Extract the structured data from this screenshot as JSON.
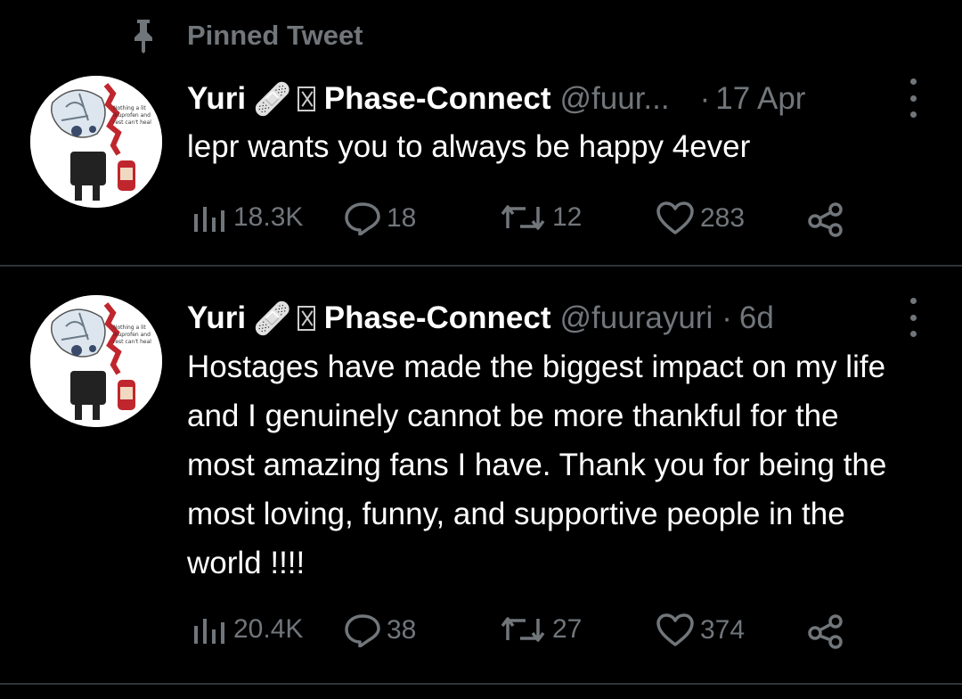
{
  "pinned": {
    "label": "Pinned Tweet",
    "icon": "pin-icon"
  },
  "tweets": [
    {
      "author_name": "Yuri",
      "emoji": "🩹",
      "author_suffix": "Phase-Connect",
      "handle": "@fuur...",
      "separator": "·",
      "time": "17 Apr",
      "text": "lepr wants you to always be happy 4ever",
      "views": "18.3K",
      "replies": "18",
      "retweets": "12",
      "likes": "283"
    },
    {
      "author_name": "Yuri",
      "emoji": "🩹",
      "author_suffix": "Phase-Connect",
      "handle": "@fuurayuri",
      "separator": "·",
      "time": "6d",
      "text": "Hostages have made the biggest impact on my life and I genuinely cannot be more thankful for the most amazing fans I have. Thank you for being the most loving, funny, and supportive people in the world !!!!",
      "views": "20.4K",
      "replies": "38",
      "retweets": "27",
      "likes": "374"
    }
  ],
  "colors": {
    "background": "#000000",
    "text": "#e7e9ea",
    "muted": "#71767b",
    "divider": "#2f3336"
  }
}
